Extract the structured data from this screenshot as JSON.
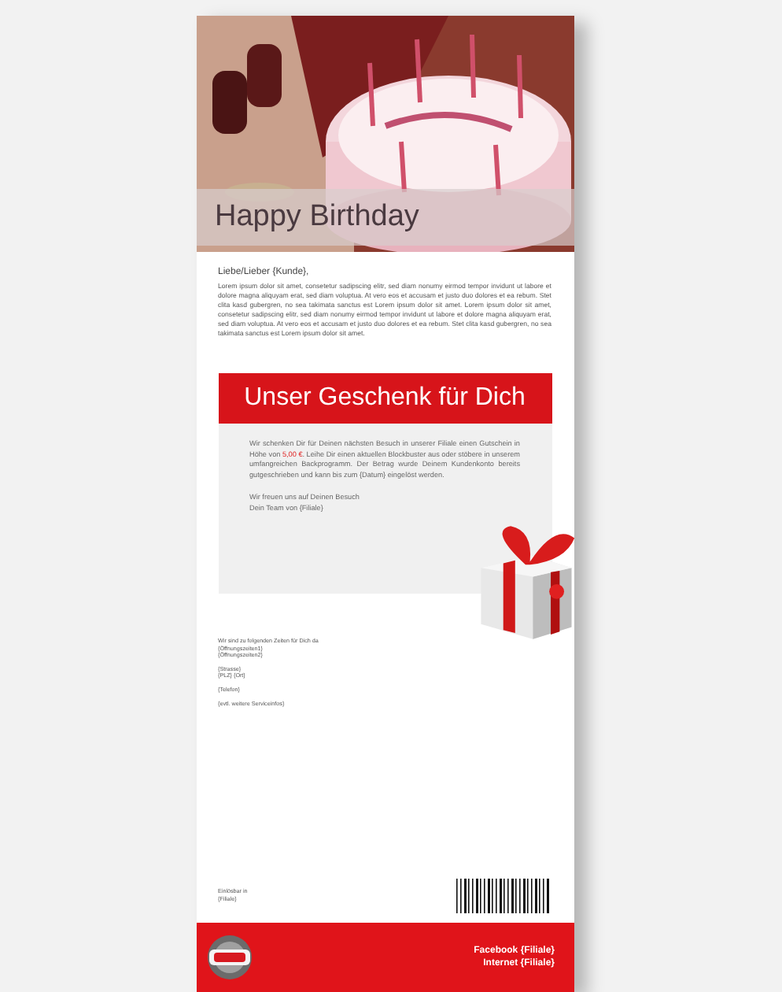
{
  "header": {
    "kind": "picture",
    "title": "Happy Birthday"
  },
  "salutation": "Liebe/Lieber {Kunde},",
  "intro": "Lorem ipsum dolor sit amet, consetetur sadipscing elitr, sed diam nonumy eirmod tempor invidunt ut labore et dolore magna aliquyam erat, sed diam voluptua. At vero eos et accusam et justo duo dolores et ea rebum. Stet clita kasd gubergren, no sea takimata sanctus est Lorem ipsum dolor sit amet. Lorem ipsum dolor sit amet, consetetur sadipscing elitr, sed diam nonumy eirmod tempor invidunt ut labore et dolore magna aliquyam erat, sed diam voluptua. At vero eos et accusam et justo duo dolores et ea rebum. Stet clita kasd gubergren, no sea takimata sanctus est Lorem ipsum dolor sit amet.",
  "gift": {
    "title": "Unser Geschenk für Dich",
    "text_before": "Wir schenken Dir für Deinen nächsten Besuch in unserer Filiale einen Gutschein in Höhe von",
    "amount": "5,00 €",
    "text_after": ". Leihe Dir einen aktuellen Blockbuster aus oder stöbere in unserem umfangreichen Backprogramm. Der Betrag wurde Deinem Kundenkonto bereits gutgeschrieben und kann bis zum {Datum} eingelöst werden.",
    "closing": [
      "Wir freuen uns auf Deinen Besuch",
      "Dein Team von {Filiale}"
    ]
  },
  "contact": [
    [
      "Wir sind zu folgenden Zeiten für Dich da",
      "{Öffnungszeiten1}",
      "{Öffnungszeiten2}"
    ],
    [
      "{Strasse}",
      "{PLZ} {Ort}"
    ],
    [
      "{Telefon}"
    ],
    [
      "{evtl. weitere Serviceinfos}"
    ]
  ],
  "voucher": [
    "Einlösbar in",
    "{Filiale}"
  ],
  "footer": [
    "Facebook {Filiale}",
    "Internet {Filiale}"
  ]
}
